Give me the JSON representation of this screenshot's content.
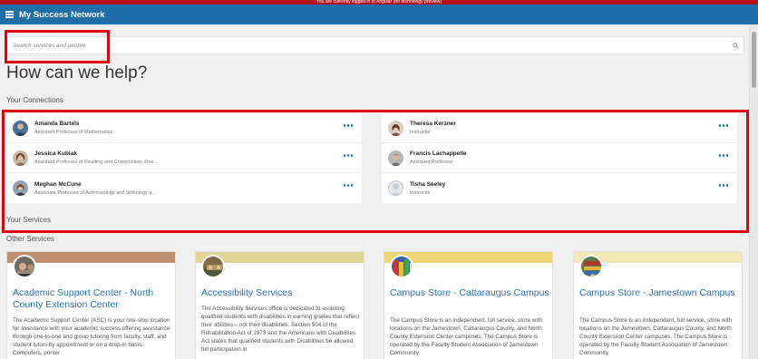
{
  "notice": "You are currently logged in to Angular (for technology preview)",
  "header": {
    "title": "My Success Network"
  },
  "search": {
    "placeholder": "Search services and people"
  },
  "help_title": "How can we help?",
  "connections": {
    "label": "Your Connections",
    "left": [
      {
        "name": "Amanda Bartels",
        "role": "Assistant Professor of Mathematics"
      },
      {
        "name": "Jessica Kubiak",
        "role": "Assistant Professor of Reading and Composition, Dire..."
      },
      {
        "name": "Meghan McCune",
        "role": "Associate Professor of Anthropology and Sociology a..."
      }
    ],
    "right": [
      {
        "name": "Theresa Kerzner",
        "role": "Instructor"
      },
      {
        "name": "Francis Lachappelle",
        "role": "Assistant Professor"
      },
      {
        "name": "Tisha Seeley",
        "role": "Instructor"
      }
    ]
  },
  "your_services": {
    "label": "Your Services"
  },
  "other_services": {
    "label": "Other Services",
    "cards": [
      {
        "title": "Academic Support Center - North County Extension Center",
        "description": "The Academic Support Center (ASC) is your one-stop location for assistance with your academic success offering assistance through one-to-one and group tutoring from faculty, staff, and student tutors by appointment or on a drop-in basis. Computers, printer",
        "band_color": "#bd9170"
      },
      {
        "title": "Accessibility Services",
        "description": "The Accessibility Services office is dedicated to assisting qualified students with disabilities in earning grades that reflect their abilities – not their disabilities. Section 504 of the Rehabilitation Act of 1973 and the Americans with Disabilities Act states that qualified students with Disabilities be allowed full participation in",
        "band_color": "#e0d396"
      },
      {
        "title": "Campus Store - Cattaraugus Campus",
        "description": "The Campus Store is an independent, full service, store with locations on the Jamestown, Cattaraugus County, and North County Extension Center campuses. The Campus Store is operated by the Faculty Student Association of Jamestown Community",
        "band_color": "#ecd676"
      },
      {
        "title": "Campus Store - Jamestown Campus",
        "description": "The Campus Store is an independent, full service, store with locations on the Jamestown, Cattaraugus County, and North County Extension Center campuses. The Campus Store is operated by the Faculty Student Association of Jamestown Community",
        "band_color": "#f1e8b5"
      }
    ]
  },
  "colors": {
    "header": "#1f6ea8",
    "highlight": "#e0000f",
    "link": "#2a73b8"
  }
}
